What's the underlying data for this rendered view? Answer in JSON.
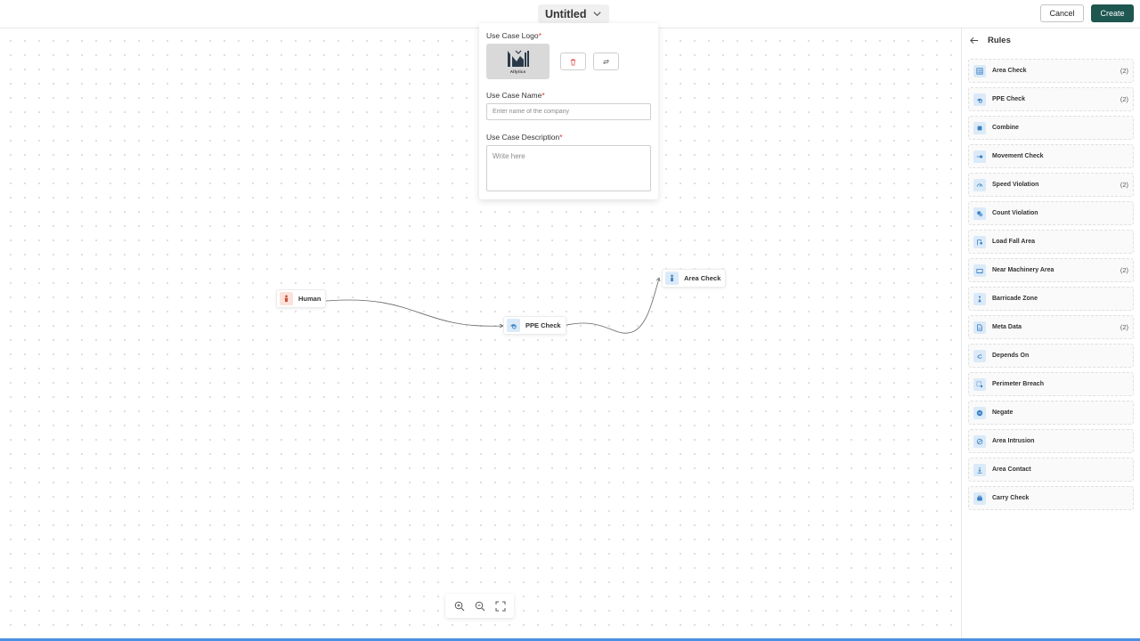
{
  "header": {
    "title": "Untitled",
    "cancel_label": "Cancel",
    "create_label": "Create"
  },
  "form": {
    "logo_label": "Use Case Logo",
    "logo_brand": "Allytics",
    "name_label": "Use Case Name",
    "name_placeholder": "Enter name of the company",
    "name_value": "",
    "description_label": "Use Case Description",
    "description_placeholder": "Write here",
    "required_mark": "*"
  },
  "canvas": {
    "nodes": [
      {
        "label": "Human",
        "icon": "human-icon",
        "color": "#fde2dc"
      },
      {
        "label": "PPE Check",
        "icon": "ppe-icon",
        "color": "#dbeaf8"
      },
      {
        "label": "Area Check",
        "icon": "area-person-icon",
        "color": "#dbeaf8"
      }
    ]
  },
  "sidebar": {
    "title": "Rules",
    "items": [
      {
        "label": "Area Check",
        "count": "(2)",
        "icon": "grid-icon"
      },
      {
        "label": "PPE Check",
        "count": "(2)",
        "icon": "ppe-icon"
      },
      {
        "label": "Combine",
        "count": "",
        "icon": "combine-icon"
      },
      {
        "label": "Movement Check",
        "count": "",
        "icon": "movement-icon"
      },
      {
        "label": "Speed Violation",
        "count": "(2)",
        "icon": "speedometer-icon"
      },
      {
        "label": "Count Violation",
        "count": "",
        "icon": "count-icon"
      },
      {
        "label": "Load Fall Area",
        "count": "",
        "icon": "load-icon"
      },
      {
        "label": "Near Machinery Area",
        "count": "(2)",
        "icon": "machinery-icon"
      },
      {
        "label": "Barricade Zone",
        "count": "",
        "icon": "barricade-icon"
      },
      {
        "label": "Meta Data",
        "count": "(2)",
        "icon": "meta-icon"
      },
      {
        "label": "Depends On",
        "count": "",
        "icon": "link-icon"
      },
      {
        "label": "Perimeter Breach",
        "count": "",
        "icon": "perimeter-icon"
      },
      {
        "label": "Negate",
        "count": "",
        "icon": "negate-icon"
      },
      {
        "label": "Area Intrusion",
        "count": "",
        "icon": "intrusion-icon"
      },
      {
        "label": "Area Contact",
        "count": "",
        "icon": "contact-icon"
      },
      {
        "label": "Carry Check",
        "count": "",
        "icon": "carry-icon"
      }
    ]
  }
}
